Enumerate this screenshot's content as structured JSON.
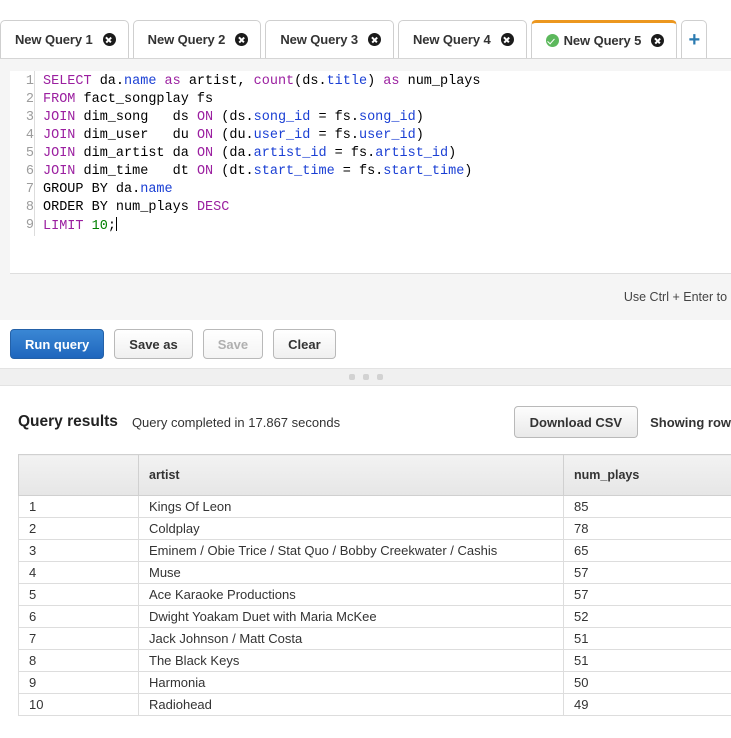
{
  "tabs": {
    "items": [
      {
        "label": "New Query 1",
        "active": false,
        "has_status_icon": false
      },
      {
        "label": "New Query 2",
        "active": false,
        "has_status_icon": false
      },
      {
        "label": "New Query 3",
        "active": false,
        "has_status_icon": false
      },
      {
        "label": "New Query 4",
        "active": false,
        "has_status_icon": false
      },
      {
        "label": "New Query 5",
        "active": true,
        "has_status_icon": true
      }
    ],
    "add_label": "+",
    "active_accent_color": "#ec971f",
    "status_icon_color": "#5cb85c"
  },
  "editor": {
    "line_numbers": [
      "1",
      "2",
      "3",
      "4",
      "5",
      "6",
      "7",
      "8",
      "9"
    ],
    "query_text": "SELECT da.name as artist, count(ds.title) as num_plays\nFROM fact_songplay fs\nJOIN dim_song   ds ON (ds.song_id = fs.song_id)\nJOIN dim_user   du ON (du.user_id = fs.user_id)\nJOIN dim_artist da ON (da.artist_id = fs.artist_id)\nJOIN dim_time   dt ON (dt.start_time = fs.start_time)\nGROUP BY da.name\nORDER BY num_plays DESC\nLIMIT 10;",
    "hint": "Use Ctrl + Enter to run q"
  },
  "toolbar": {
    "run_label": "Run query",
    "save_as_label": "Save as",
    "save_label": "Save",
    "clear_label": "Clear",
    "primary_color": "#2f7dc9"
  },
  "results": {
    "title": "Query results",
    "status": "Query completed in 17.867 seconds",
    "download_label": "Download CSV",
    "showing_rows_label": "Showing row",
    "columns": [
      "",
      "artist",
      "num_plays"
    ],
    "rows": [
      {
        "idx": "1",
        "artist": "Kings Of Leon",
        "num_plays": "85"
      },
      {
        "idx": "2",
        "artist": "Coldplay",
        "num_plays": "78"
      },
      {
        "idx": "3",
        "artist": "Eminem / Obie Trice / Stat Quo / Bobby Creekwater / Cashis",
        "num_plays": "65"
      },
      {
        "idx": "4",
        "artist": "Muse",
        "num_plays": "57"
      },
      {
        "idx": "5",
        "artist": "Ace Karaoke Productions",
        "num_plays": "57"
      },
      {
        "idx": "6",
        "artist": "Dwight Yoakam Duet with Maria McKee",
        "num_plays": "52"
      },
      {
        "idx": "7",
        "artist": "Jack Johnson / Matt Costa",
        "num_plays": "51"
      },
      {
        "idx": "8",
        "artist": "The Black Keys",
        "num_plays": "51"
      },
      {
        "idx": "9",
        "artist": "Harmonia",
        "num_plays": "50"
      },
      {
        "idx": "10",
        "artist": "Radiohead",
        "num_plays": "49"
      }
    ]
  }
}
